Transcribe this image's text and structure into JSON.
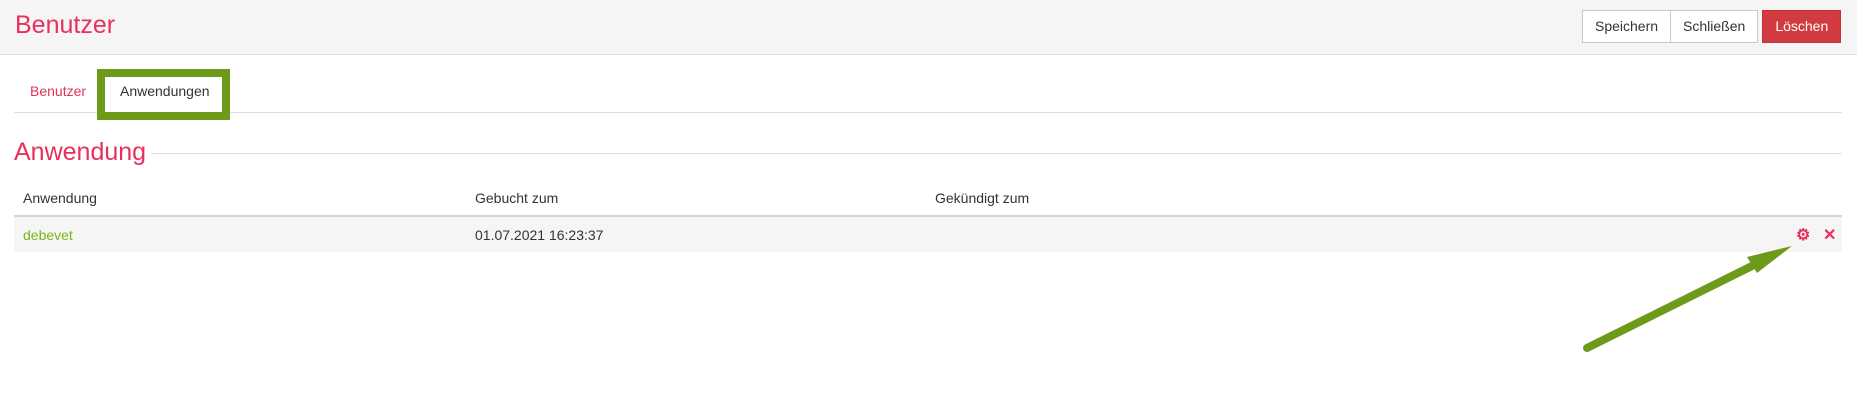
{
  "header": {
    "title": "Benutzer",
    "save_label": "Speichern",
    "close_label": "Schließen",
    "delete_label": "Löschen"
  },
  "tabs": [
    {
      "label": "Benutzer"
    },
    {
      "label": "Anwendungen"
    }
  ],
  "section": {
    "title": "Anwendung"
  },
  "table": {
    "columns": [
      "Anwendung",
      "Gebucht zum",
      "Gekündigt zum"
    ],
    "rows": [
      {
        "anwendung": "debevet",
        "gebucht": "01.07.2021 16:23:37",
        "gekuendigt": "",
        "actions": [
          "gear-icon",
          "close-icon"
        ]
      }
    ]
  },
  "colors": {
    "accent": "#e8305a",
    "danger": "#d23b40",
    "link": "#7cb518",
    "annotation": "#6e9a1a"
  }
}
